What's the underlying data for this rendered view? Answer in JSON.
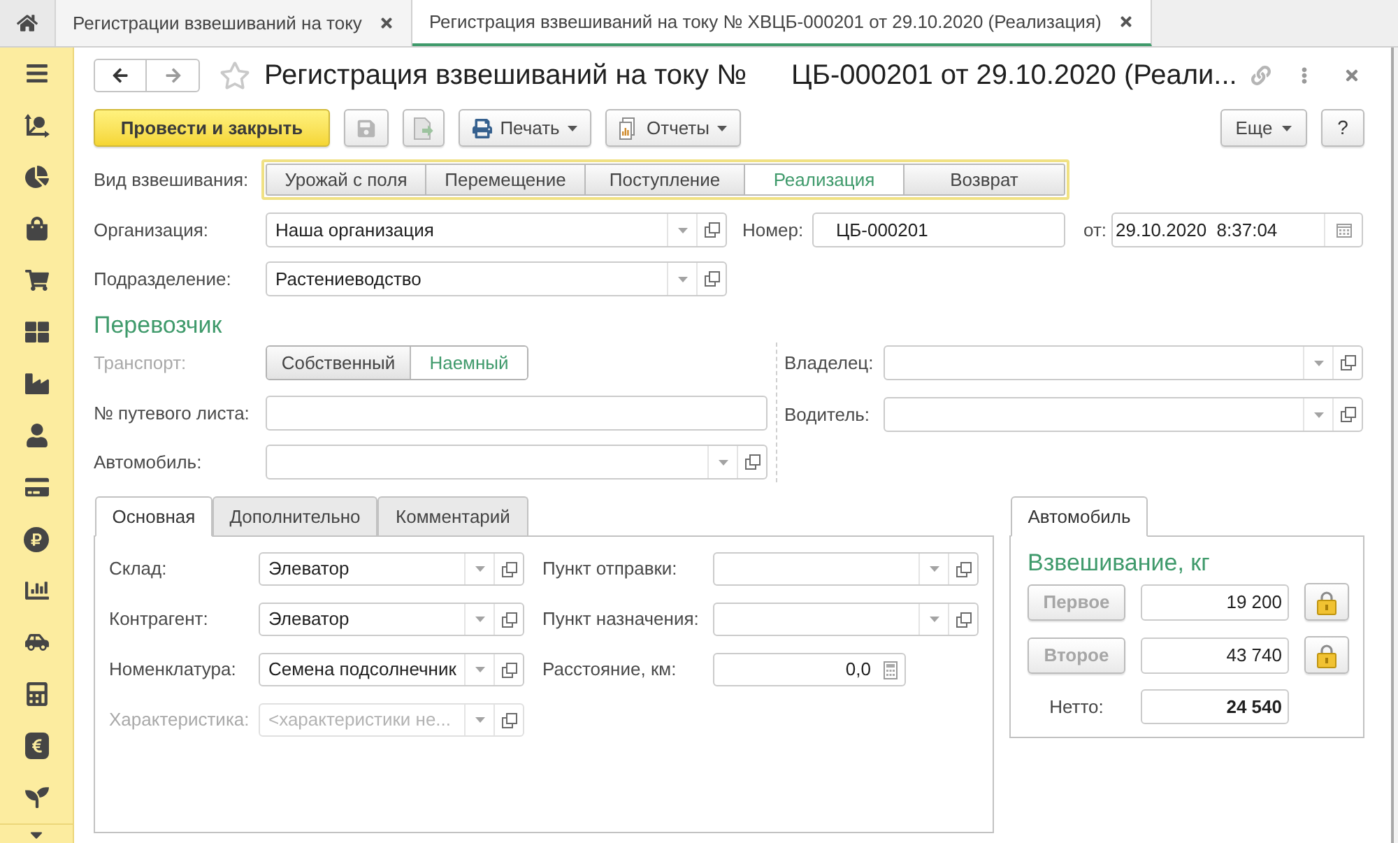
{
  "app_tabs": [
    {
      "label": "Регистрации взвешиваний на току",
      "selected": false
    },
    {
      "label": "Регистрация взвешиваний на току № ХВЦБ-000201 от 29.10.2020 (Реализация)",
      "selected": true
    }
  ],
  "form": {
    "title": [
      "Регистрация взвешиваний на току №",
      "ЦБ-000201 от 29.10.2020 (Реали..."
    ],
    "toolbar": {
      "post_and_close": "Провести и закрыть",
      "print": "Печать",
      "reports": "Отчеты",
      "more": "Еще",
      "help": "?"
    },
    "weighing_type": {
      "label": "Вид взвешивания:",
      "options": [
        {
          "label": "Урожай с поля",
          "selected": false
        },
        {
          "label": "Перемещение",
          "selected": false
        },
        {
          "label": "Поступление",
          "selected": false
        },
        {
          "label": "Реализация",
          "selected": true
        },
        {
          "label": "Возврат",
          "selected": false
        }
      ]
    },
    "organization": {
      "label": "Организация:",
      "value": "Наша организация"
    },
    "number": {
      "label": "Номер:",
      "value": "ЦБ-000201"
    },
    "date": {
      "label": "от:",
      "value": "29.10.2020  8:37:04"
    },
    "division": {
      "label": "Подразделение:",
      "value": "Растениеводство"
    },
    "carrier": {
      "heading": "Перевозчик",
      "transport": {
        "label": "Транспорт:",
        "disabled": true,
        "options": [
          {
            "label": "Собственный",
            "selected": false
          },
          {
            "label": "Наемный",
            "selected": true
          }
        ]
      },
      "waybill": {
        "label": "№ путевого листа:"
      },
      "car": {
        "label": "Автомобиль:"
      },
      "owner": {
        "label": "Владелец:"
      },
      "driver": {
        "label": "Водитель:"
      }
    },
    "details": {
      "tabs": [
        {
          "label": "Основная",
          "selected": true
        },
        {
          "label": "Дополнительно",
          "selected": false
        },
        {
          "label": "Комментарий",
          "selected": false
        }
      ],
      "left_fields": [
        {
          "kind": "select",
          "label": "Склад:",
          "value": "Элеватор",
          "disabled": false
        },
        {
          "kind": "select",
          "label": "Контрагент:",
          "value": "Элеватор",
          "disabled": false
        },
        {
          "kind": "select",
          "label": "Номенклатура:",
          "value": "Семена подсолнечник",
          "disabled": false
        },
        {
          "kind": "select",
          "label": "Характеристика:",
          "placeholder": "<характеристики не...",
          "disabled": true
        }
      ],
      "right_fields": [
        {
          "kind": "select",
          "label": "Пункт отправки:"
        },
        {
          "kind": "select",
          "label": "Пункт назначения:"
        },
        {
          "kind": "number",
          "label": "Расстояние, км:",
          "value": "0,0"
        }
      ]
    },
    "weighing": {
      "tab": {
        "label": "Автомобиль",
        "selected": true
      },
      "heading": "Взвешивание, кг",
      "rows": [
        {
          "button": "Первое",
          "disabled": true,
          "value": "19 200"
        },
        {
          "button": "Второе",
          "disabled": true,
          "value": "43 740"
        }
      ],
      "net": {
        "label": "Нетто:",
        "value": "24 540"
      }
    }
  }
}
